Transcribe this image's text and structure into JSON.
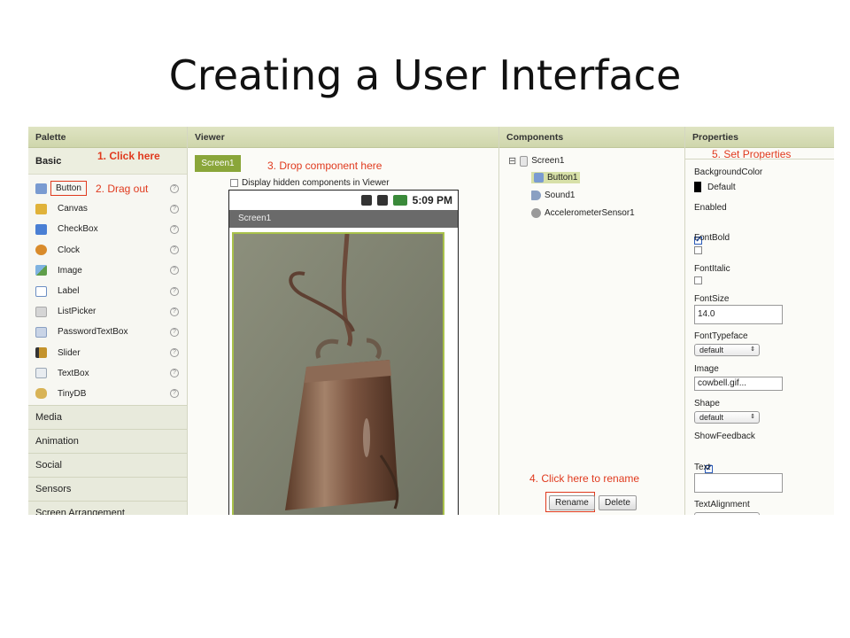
{
  "slide_title": "Creating a User Interface",
  "palette": {
    "header": "Palette",
    "basic_label": "Basic",
    "step1": "1. Click here",
    "step2": "2. Drag out",
    "help_glyph": "?",
    "items": [
      {
        "label": "Button",
        "icon": "button-icon",
        "color": "#7a9bd1"
      },
      {
        "label": "Canvas",
        "icon": "canvas-icon",
        "color": "#e0b23a"
      },
      {
        "label": "CheckBox",
        "icon": "checkbox-icon",
        "color": "#4a7fd4"
      },
      {
        "label": "Clock",
        "icon": "clock-icon",
        "color": "#d98b2b"
      },
      {
        "label": "Image",
        "icon": "image-icon",
        "color": "#5f9e4a"
      },
      {
        "label": "Label",
        "icon": "label-icon",
        "color": "#6d8fc4"
      },
      {
        "label": "ListPicker",
        "icon": "listpicker-icon",
        "color": "#b9b9b9"
      },
      {
        "label": "PasswordTextBox",
        "icon": "password-icon",
        "color": "#8aa0c2"
      },
      {
        "label": "Slider",
        "icon": "slider-icon",
        "color": "#c4932c"
      },
      {
        "label": "TextBox",
        "icon": "textbox-icon",
        "color": "#9aa7b5"
      },
      {
        "label": "TinyDB",
        "icon": "database-icon",
        "color": "#d8b356"
      }
    ],
    "categories": [
      "Media",
      "Animation",
      "Social",
      "Sensors",
      "Screen Arrangement"
    ]
  },
  "viewer": {
    "header": "Viewer",
    "screen_tab": "Screen1",
    "step3": "3. Drop component here",
    "hidden_checkbox_label": "Display hidden components in Viewer",
    "phone_time": "5:09 PM",
    "phone_title": "Screen1"
  },
  "components": {
    "header": "Components",
    "collapse_glyph": "⊟",
    "tree": {
      "root": "Screen1",
      "children": [
        "Button1",
        "Sound1",
        "AccelerometerSensor1"
      ]
    },
    "step4": "4. Click here to rename",
    "rename_label": "Rename",
    "delete_label": "Delete"
  },
  "properties": {
    "header": "Properties",
    "step5": "5. Set Properties",
    "background_color_label": "BackgroundColor",
    "background_color_value": "Default",
    "enabled_label": "Enabled",
    "fontbold_label": "FontBold",
    "fontitalic_label": "FontItalic",
    "fontsize_label": "FontSize",
    "fontsize_value": "14.0",
    "fonttypeface_label": "FontTypeface",
    "fonttypeface_value": "default",
    "image_label": "Image",
    "image_value": "cowbell.gif...",
    "shape_label": "Shape",
    "shape_value": "default",
    "showfeedback_label": "ShowFeedback",
    "text_label": "Text",
    "text_value": "",
    "textalignment_label": "TextAlignment",
    "dropdown_glyph": "⇕"
  },
  "colors": {
    "accent_red": "#e03a1e",
    "header_green": "#cfd6ac",
    "tab_green": "#8aa63a"
  }
}
